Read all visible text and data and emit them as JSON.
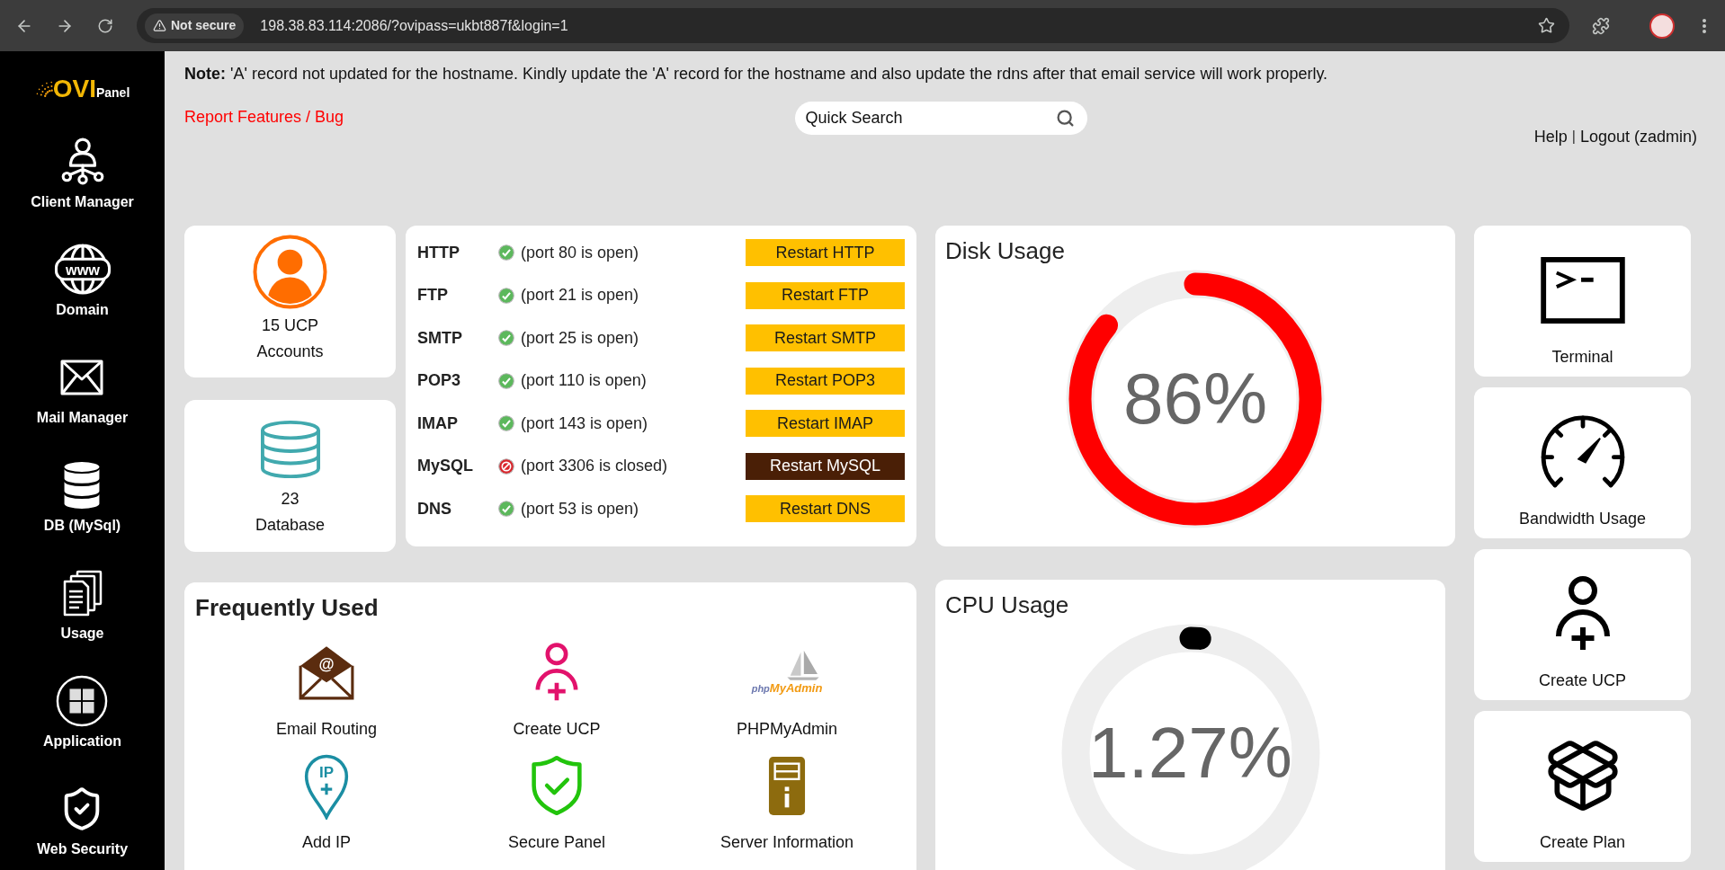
{
  "browser": {
    "security_label": "Not secure",
    "url": "198.38.83.114:2086/?ovipass=ukbt887f&login=1"
  },
  "sidebar": {
    "logo": {
      "brand": "OVI",
      "suffix": "Panel"
    },
    "items": [
      {
        "label": "Client Manager"
      },
      {
        "label": "Domain",
        "icon_text": "www"
      },
      {
        "label": "Mail Manager"
      },
      {
        "label": "DB (MySql)"
      },
      {
        "label": "Usage"
      },
      {
        "label": "Application"
      },
      {
        "label": "Web Security"
      }
    ]
  },
  "notice": "**Note:** 'A' record not updated for the hostname. Kindly update the 'A' record for the hostname and also update the rdns after that email service will work properly.",
  "header": {
    "report_link": "Report Features / Bug",
    "search": {
      "placeholder": "Quick Search"
    },
    "help_link": "Help",
    "separator": "|",
    "logout_link": "Logout (zadmin)"
  },
  "stats": [
    {
      "count": "15 UCP",
      "label": "Accounts"
    },
    {
      "count": "23",
      "label": "Database"
    }
  ],
  "services": [
    {
      "name": "HTTP",
      "status": "(port 80 is open)",
      "open": true,
      "button": "Restart HTTP"
    },
    {
      "name": "FTP",
      "status": "(port 21 is open)",
      "open": true,
      "button": "Restart FTP"
    },
    {
      "name": "SMTP",
      "status": "(port 25 is open)",
      "open": true,
      "button": "Restart SMTP"
    },
    {
      "name": "POP3",
      "status": "(port 110 is open)",
      "open": true,
      "button": "Restart POP3"
    },
    {
      "name": "IMAP",
      "status": "(port 143 is open)",
      "open": true,
      "button": "Restart IMAP"
    },
    {
      "name": "MySQL",
      "status": "(port 3306 is closed)",
      "open": false,
      "button": "Restart MySQL"
    },
    {
      "name": "DNS",
      "status": "(port 53 is open)",
      "open": true,
      "button": "Restart DNS"
    }
  ],
  "gauges": [
    {
      "title": "Disk Usage",
      "value": "86%",
      "level": 0.86,
      "color": "#ff0000"
    },
    {
      "title": "CPU Usage",
      "value": "1.27%",
      "level": 0.0127,
      "color": "#000000"
    }
  ],
  "tools": [
    {
      "label": "Terminal"
    },
    {
      "label": "Bandwidth Usage"
    },
    {
      "label": "Create UCP"
    },
    {
      "label": "Create Plan"
    }
  ],
  "frequently_used": {
    "title": "Frequently Used",
    "items": [
      {
        "label": "Email Routing",
        "icon_text": "@"
      },
      {
        "label": "Create UCP"
      },
      {
        "label": "PHPMyAdmin",
        "logo_text": [
          "php",
          "MyAdmin"
        ]
      },
      {
        "label": "Add IP",
        "icon_text": "IP"
      },
      {
        "label": "Secure Panel"
      },
      {
        "label": "Server Information"
      }
    ]
  }
}
